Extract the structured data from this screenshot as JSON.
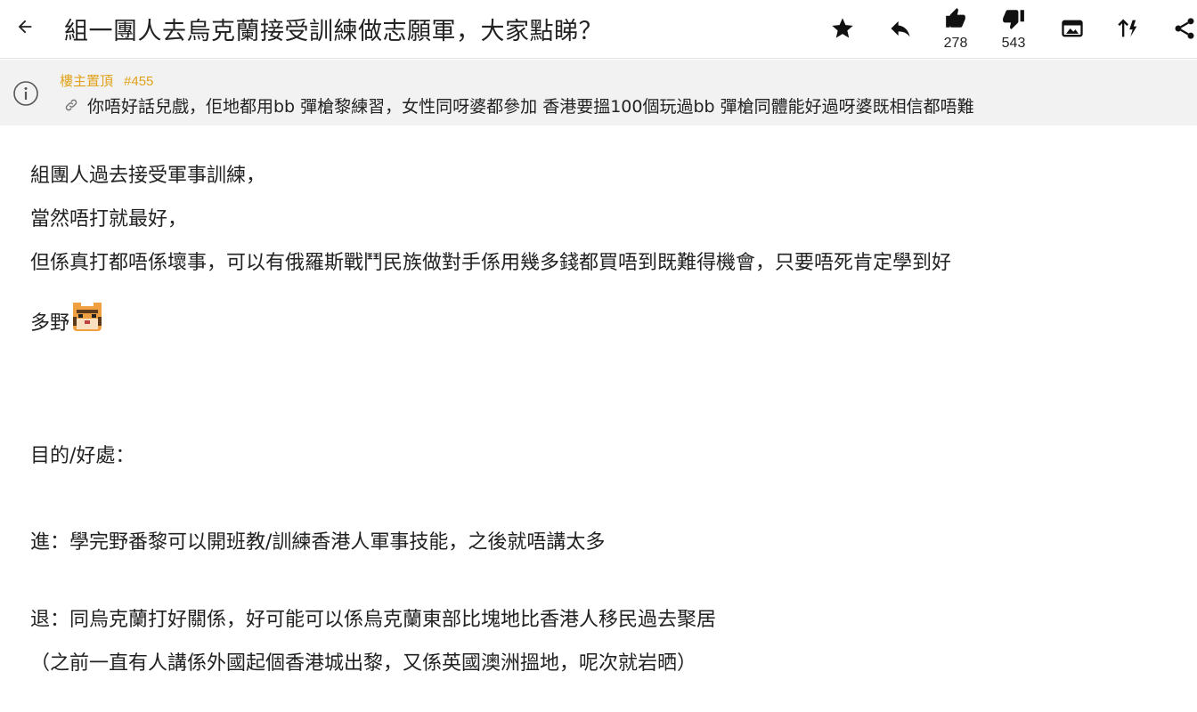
{
  "header": {
    "back_icon": "arrow-left-icon",
    "title": "組一團人去烏克蘭接受訓練做志願軍，大家點睇？",
    "buttons": {
      "star_icon": "star-icon",
      "reply_icon": "reply-icon",
      "like_icon": "thumbs-up-icon",
      "like_count": "278",
      "dislike_icon": "thumbs-down-icon",
      "dislike_count": "543",
      "image_icon": "image-mode-icon",
      "sort_icon": "sort-icon",
      "share_icon": "share-icon"
    }
  },
  "pinned": {
    "label": "樓主置頂",
    "post_no": "#455",
    "text": "你唔好話兒戲，佢地都用bb 彈槍黎練習，女性同呀婆都參加 香港要搵100個玩過bb 彈槍同體能好過呀婆既相信都唔難"
  },
  "content": {
    "line1": "組團人過去接受軍事訓練，",
    "line2": "當然唔打就最好，",
    "line3": "但係真打都唔係壞事，可以有俄羅斯戰鬥民族做對手係用幾多錢都買唔到既難得機會，只要唔死肯定學到好",
    "line4": "多野",
    "line5": "目的/好處：",
    "line6": "進：學完野番黎可以開班教/訓練香港人軍事技能，之後就唔講太多",
    "line7": "退：同烏克蘭打好關係，好可能可以係烏克蘭東部比塊地比香港人移民過去聚居",
    "line8": "（之前一直有人講係外國起個香港城出黎，又係英國澳洲搵地，呢次就岩晒）"
  },
  "colors": {
    "accent": "#e0a21b",
    "pinned_bg": "#f2f2f2",
    "text": "#222222"
  }
}
